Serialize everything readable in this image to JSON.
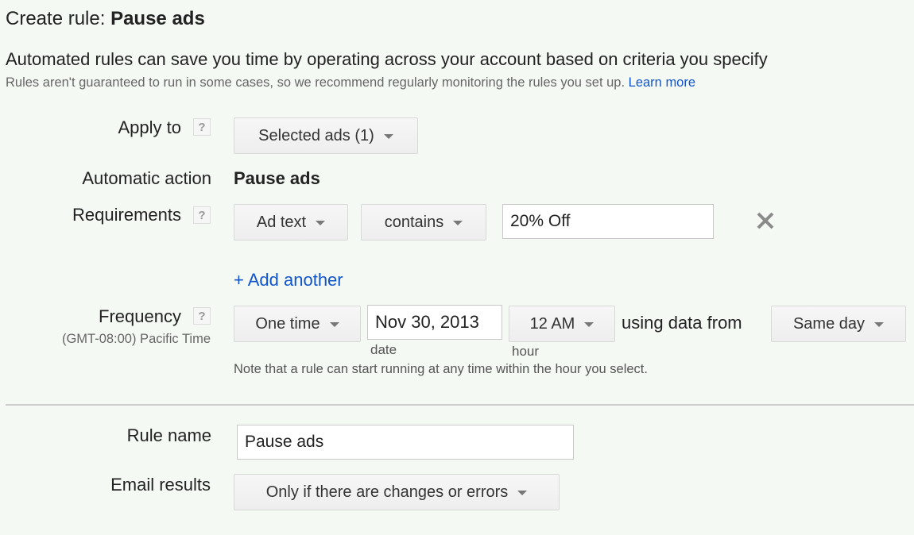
{
  "header": {
    "title_prefix": "Create rule: ",
    "title_rule": "Pause ads",
    "intro": "Automated rules can save you time by operating across your account based on criteria you specify",
    "disclaimer": "Rules aren't guaranteed to run in some cases, so we recommend regularly monitoring the rules you set up.",
    "learn_more": "Learn more"
  },
  "form": {
    "help_glyph": "?",
    "apply_to": {
      "label": "Apply to",
      "value": "Selected ads (1)"
    },
    "automatic_action": {
      "label": "Automatic action",
      "value": "Pause ads"
    },
    "requirements": {
      "label": "Requirements",
      "field": "Ad text",
      "operator": "contains",
      "value": "20% Off",
      "add_another": "+ Add another"
    },
    "frequency": {
      "label": "Frequency",
      "timezone": "(GMT-08:00) Pacific Time",
      "schedule": "One time",
      "date": "Nov 30, 2013",
      "date_caption": "date",
      "hour": "12 AM",
      "hour_caption": "hour",
      "using_data_from_label": "using data from",
      "data_range": "Same day",
      "note": "Note that a rule can start running at any time within the hour you select."
    },
    "rule_name": {
      "label": "Rule name",
      "value": "Pause ads"
    },
    "email_results": {
      "label": "Email results",
      "value": "Only if there are changes or errors"
    }
  },
  "colors": {
    "background": "#f4f9f4",
    "link": "#1155cc",
    "muted_text": "#666666"
  }
}
